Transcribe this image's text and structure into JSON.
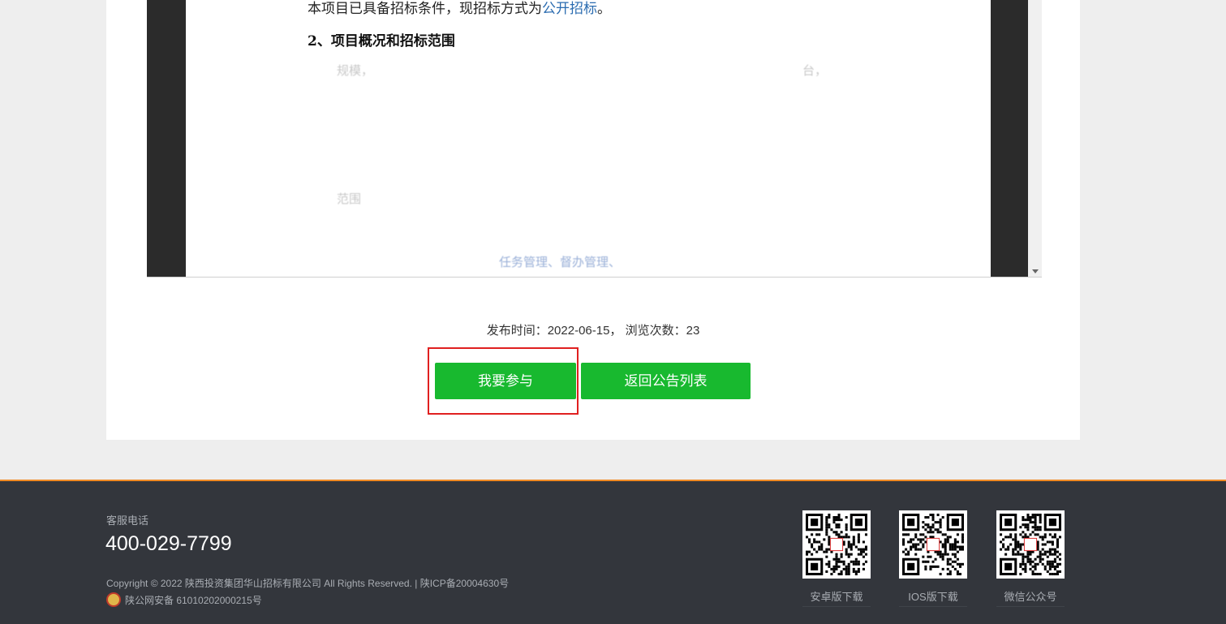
{
  "document": {
    "line1_text": "本项目已具备招标条件，现招标方式为",
    "line1_link": "公开招标",
    "line1_end": "。",
    "heading": "2、项目概况和招标范围",
    "faint1": "规模，",
    "faint2": "台，",
    "faint3": "范围",
    "faint4": "任务管理、督办管理、"
  },
  "meta": {
    "text": "发布时间：2022-06-15， 浏览次数：23"
  },
  "buttons": {
    "join_label": "我要参与",
    "back_label": "返回公告列表"
  },
  "footer": {
    "service_label": "客服电话",
    "phone": "400-029-7799",
    "copyright": "Copyright © 2022 陕西投资集团华山招标有限公司 All Rights Reserved. | 陕ICP备20004630号",
    "police_record": "陕公网安备 61010202000215号",
    "qr_codes": [
      {
        "label": "安卓版下载",
        "icon": "qr-code-icon"
      },
      {
        "label": "IOS版下载",
        "icon": "qr-code-icon"
      },
      {
        "label": "微信公众号",
        "icon": "qr-code-icon"
      }
    ]
  },
  "colors": {
    "button_green": "#18b92f",
    "highlight_red": "#e02020",
    "footer_bg": "#33363c",
    "footer_accent": "#f08a24"
  }
}
